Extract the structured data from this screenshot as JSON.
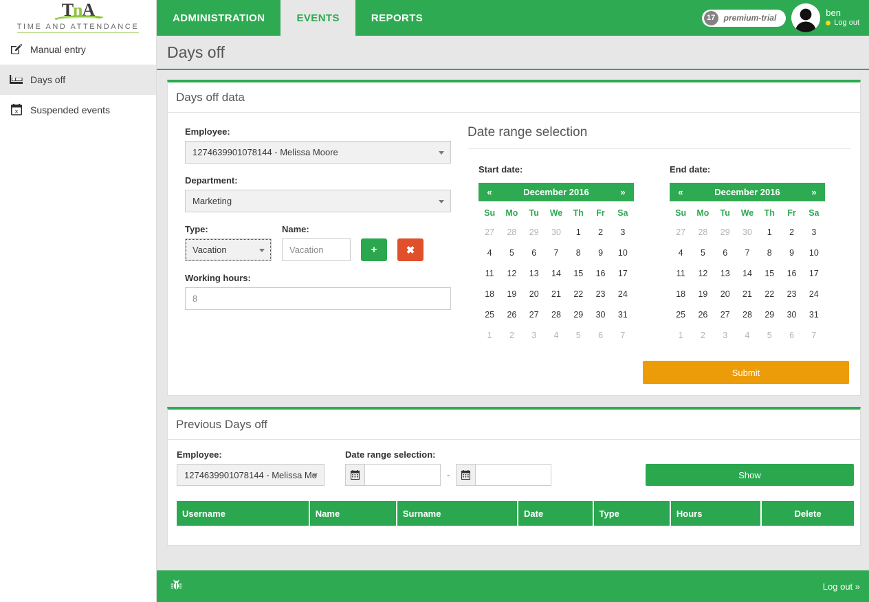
{
  "brand": {
    "logo_text": "TnA",
    "logo_t": "T",
    "logo_n": "n",
    "logo_a": "A",
    "tagline": "TIME AND ATTENDANCE",
    "accent_green": "#2eaa52",
    "accent_orange": "#ed9c09",
    "accent_red": "#e0502a",
    "logo_green": "#8cc63e"
  },
  "sidebar": {
    "items": [
      {
        "label": "Manual entry",
        "icon": "pencil-square-icon",
        "active": false
      },
      {
        "label": "Days off",
        "icon": "bed-icon",
        "active": true
      },
      {
        "label": "Suspended events",
        "icon": "calendar-times-icon",
        "active": false
      }
    ]
  },
  "topnav": {
    "tabs": [
      {
        "label": "ADMINISTRATION",
        "active": false
      },
      {
        "label": "EVENTS",
        "active": true
      },
      {
        "label": "REPORTS",
        "active": false
      }
    ]
  },
  "user": {
    "plan_count": "17",
    "plan_name": "premium-trial",
    "name": "ben",
    "logout_label": "Log out",
    "status_color": "#f2d91c"
  },
  "page": {
    "title": "Days off"
  },
  "days_off_panel": {
    "title": "Days off data",
    "employee_label": "Employee:",
    "employee_value": "1274639901078144 - Melissa Moore",
    "department_label": "Department:",
    "department_value": "Marketing",
    "type_label": "Type:",
    "type_value": "Vacation",
    "name_label": "Name:",
    "name_value": "Vacation",
    "add_label": "+",
    "remove_label": "✖",
    "working_hours_label": "Working hours:",
    "working_hours_value": "8"
  },
  "date_range": {
    "title": "Date range selection",
    "start_label": "Start date:",
    "end_label": "End date:",
    "prev_arrow": "«",
    "next_arrow": "»",
    "month_title": "December 2016",
    "dow": [
      "Su",
      "Mo",
      "Tu",
      "We",
      "Th",
      "Fr",
      "Sa"
    ],
    "weeks": [
      [
        {
          "d": "27",
          "m": true
        },
        {
          "d": "28",
          "m": true
        },
        {
          "d": "29",
          "m": true
        },
        {
          "d": "30",
          "m": true
        },
        {
          "d": "1",
          "m": false
        },
        {
          "d": "2",
          "m": false
        },
        {
          "d": "3",
          "m": false
        }
      ],
      [
        {
          "d": "4",
          "m": false
        },
        {
          "d": "5",
          "m": false
        },
        {
          "d": "6",
          "m": false
        },
        {
          "d": "7",
          "m": false
        },
        {
          "d": "8",
          "m": false
        },
        {
          "d": "9",
          "m": false
        },
        {
          "d": "10",
          "m": false
        }
      ],
      [
        {
          "d": "11",
          "m": false
        },
        {
          "d": "12",
          "m": false
        },
        {
          "d": "13",
          "m": false
        },
        {
          "d": "14",
          "m": false
        },
        {
          "d": "15",
          "m": false
        },
        {
          "d": "16",
          "m": false
        },
        {
          "d": "17",
          "m": false
        }
      ],
      [
        {
          "d": "18",
          "m": false
        },
        {
          "d": "19",
          "m": false
        },
        {
          "d": "20",
          "m": false
        },
        {
          "d": "21",
          "m": false
        },
        {
          "d": "22",
          "m": false
        },
        {
          "d": "23",
          "m": false
        },
        {
          "d": "24",
          "m": false
        }
      ],
      [
        {
          "d": "25",
          "m": false
        },
        {
          "d": "26",
          "m": false
        },
        {
          "d": "27",
          "m": false
        },
        {
          "d": "28",
          "m": false
        },
        {
          "d": "29",
          "m": false
        },
        {
          "d": "30",
          "m": false
        },
        {
          "d": "31",
          "m": false
        }
      ],
      [
        {
          "d": "1",
          "m": true
        },
        {
          "d": "2",
          "m": true
        },
        {
          "d": "3",
          "m": true
        },
        {
          "d": "4",
          "m": true
        },
        {
          "d": "5",
          "m": true
        },
        {
          "d": "6",
          "m": true
        },
        {
          "d": "7",
          "m": true
        }
      ]
    ],
    "submit_label": "Submit"
  },
  "previous_panel": {
    "title": "Previous Days off",
    "employee_label": "Employee:",
    "employee_value": "1274639901078144 - Melissa Mo",
    "date_range_label": "Date range selection:",
    "from_value": "",
    "to_value": "",
    "from_placeholder": "",
    "to_placeholder": "",
    "separator": "-",
    "show_label": "Show",
    "columns": [
      "Username",
      "Name",
      "Surname",
      "Date",
      "Type",
      "Hours",
      "Delete"
    ],
    "rows": []
  },
  "footer": {
    "bug_icon": "bug-icon",
    "logout_label": "Log out »"
  }
}
